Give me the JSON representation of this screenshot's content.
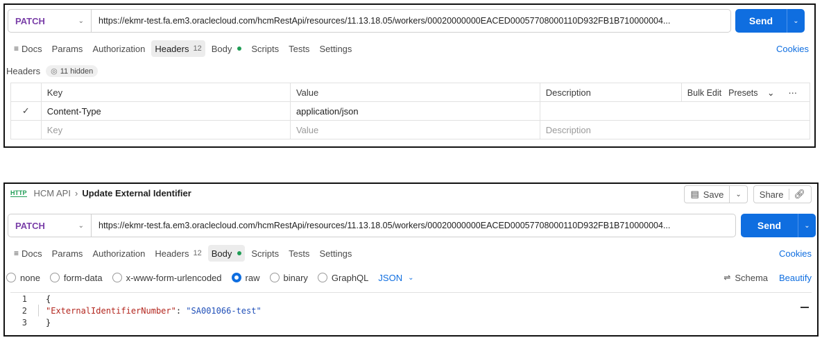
{
  "request1": {
    "method": "PATCH",
    "url": "https://ekmr-test.fa.em3.oraclecloud.com/hcmRestApi/resources/11.13.18.05/workers/00020000000EACED00057708000110D932FB1B710000004...",
    "send_label": "Send",
    "tabs": {
      "docs": "Docs",
      "params": "Params",
      "authorization": "Authorization",
      "headers": "Headers",
      "headers_count": "12",
      "body": "Body",
      "scripts": "Scripts",
      "tests": "Tests",
      "settings": "Settings"
    },
    "cookies": "Cookies",
    "headers_section": {
      "title": "Headers",
      "hidden_label": "11 hidden",
      "columns": {
        "key": "Key",
        "value": "Value",
        "description": "Description"
      },
      "bulk_edit": "Bulk Edit",
      "presets": "Presets",
      "rows": [
        {
          "key": "Content-Type",
          "value": "application/json",
          "description": ""
        }
      ],
      "placeholders": {
        "key": "Key",
        "value": "Value",
        "description": "Description"
      }
    }
  },
  "request2": {
    "breadcrumb": {
      "parent": "HCM API",
      "title": "Update External Identifier"
    },
    "save_label": "Save",
    "share_label": "Share",
    "method": "PATCH",
    "url": "https://ekmr-test.fa.em3.oraclecloud.com/hcmRestApi/resources/11.13.18.05/workers/00020000000EACED00057708000110D932FB1B710000004...",
    "send_label": "Send",
    "tabs": {
      "docs": "Docs",
      "params": "Params",
      "authorization": "Authorization",
      "headers": "Headers",
      "headers_count": "12",
      "body": "Body",
      "scripts": "Scripts",
      "tests": "Tests",
      "settings": "Settings"
    },
    "cookies": "Cookies",
    "body_modes": {
      "none": "none",
      "form_data": "form-data",
      "urlencoded": "x-www-form-urlencoded",
      "raw": "raw",
      "binary": "binary",
      "graphql": "GraphQL",
      "selected": "raw",
      "language": "JSON"
    },
    "schema": "Schema",
    "beautify": "Beautify",
    "code": {
      "line_numbers": [
        "1",
        "2",
        "3"
      ],
      "open": "{",
      "key": "\"ExternalIdentifierNumber\"",
      "colon": ": ",
      "value": "\"SA001066-test\"",
      "close": "}"
    }
  },
  "colors": {
    "accent": "#0f6ee0",
    "method": "#7a3fa8",
    "ok": "#1f9d55"
  }
}
